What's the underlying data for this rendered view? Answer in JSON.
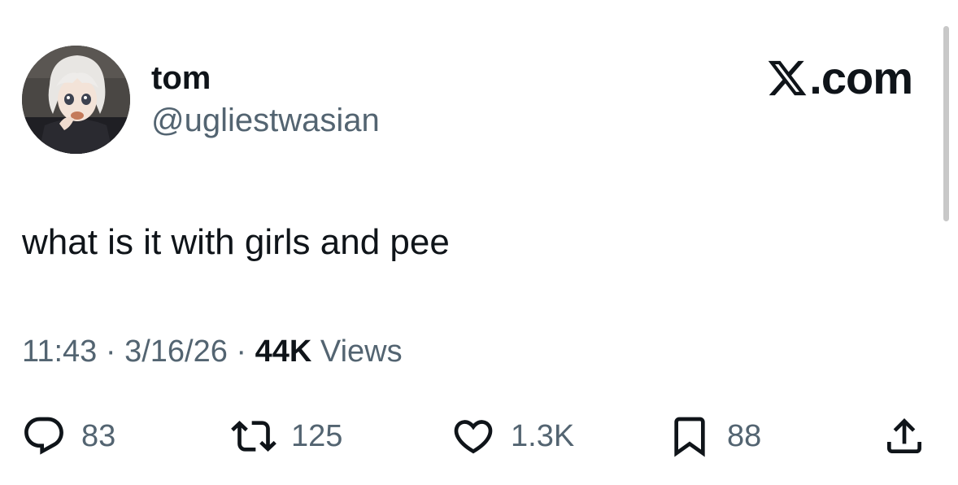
{
  "author": {
    "display_name": "tom",
    "handle": "@ugliestwasian"
  },
  "brand": {
    "icon": "x-logo-icon",
    "domain": ".com"
  },
  "tweet": {
    "text": "what is it with girls and pee"
  },
  "meta": {
    "time": "11:43",
    "separator": "·",
    "date": "3/16/26",
    "views_count": "44K",
    "views_label": "Views"
  },
  "actions": {
    "reply": {
      "icon": "reply-icon",
      "count": "83"
    },
    "retweet": {
      "icon": "retweet-icon",
      "count": "125"
    },
    "like": {
      "icon": "heart-icon",
      "count": "1.3K"
    },
    "bookmark": {
      "icon": "bookmark-icon",
      "count": "88"
    },
    "share": {
      "icon": "share-icon"
    }
  },
  "colors": {
    "text_primary": "#0f1419",
    "text_secondary": "#536471",
    "background": "#ffffff"
  }
}
